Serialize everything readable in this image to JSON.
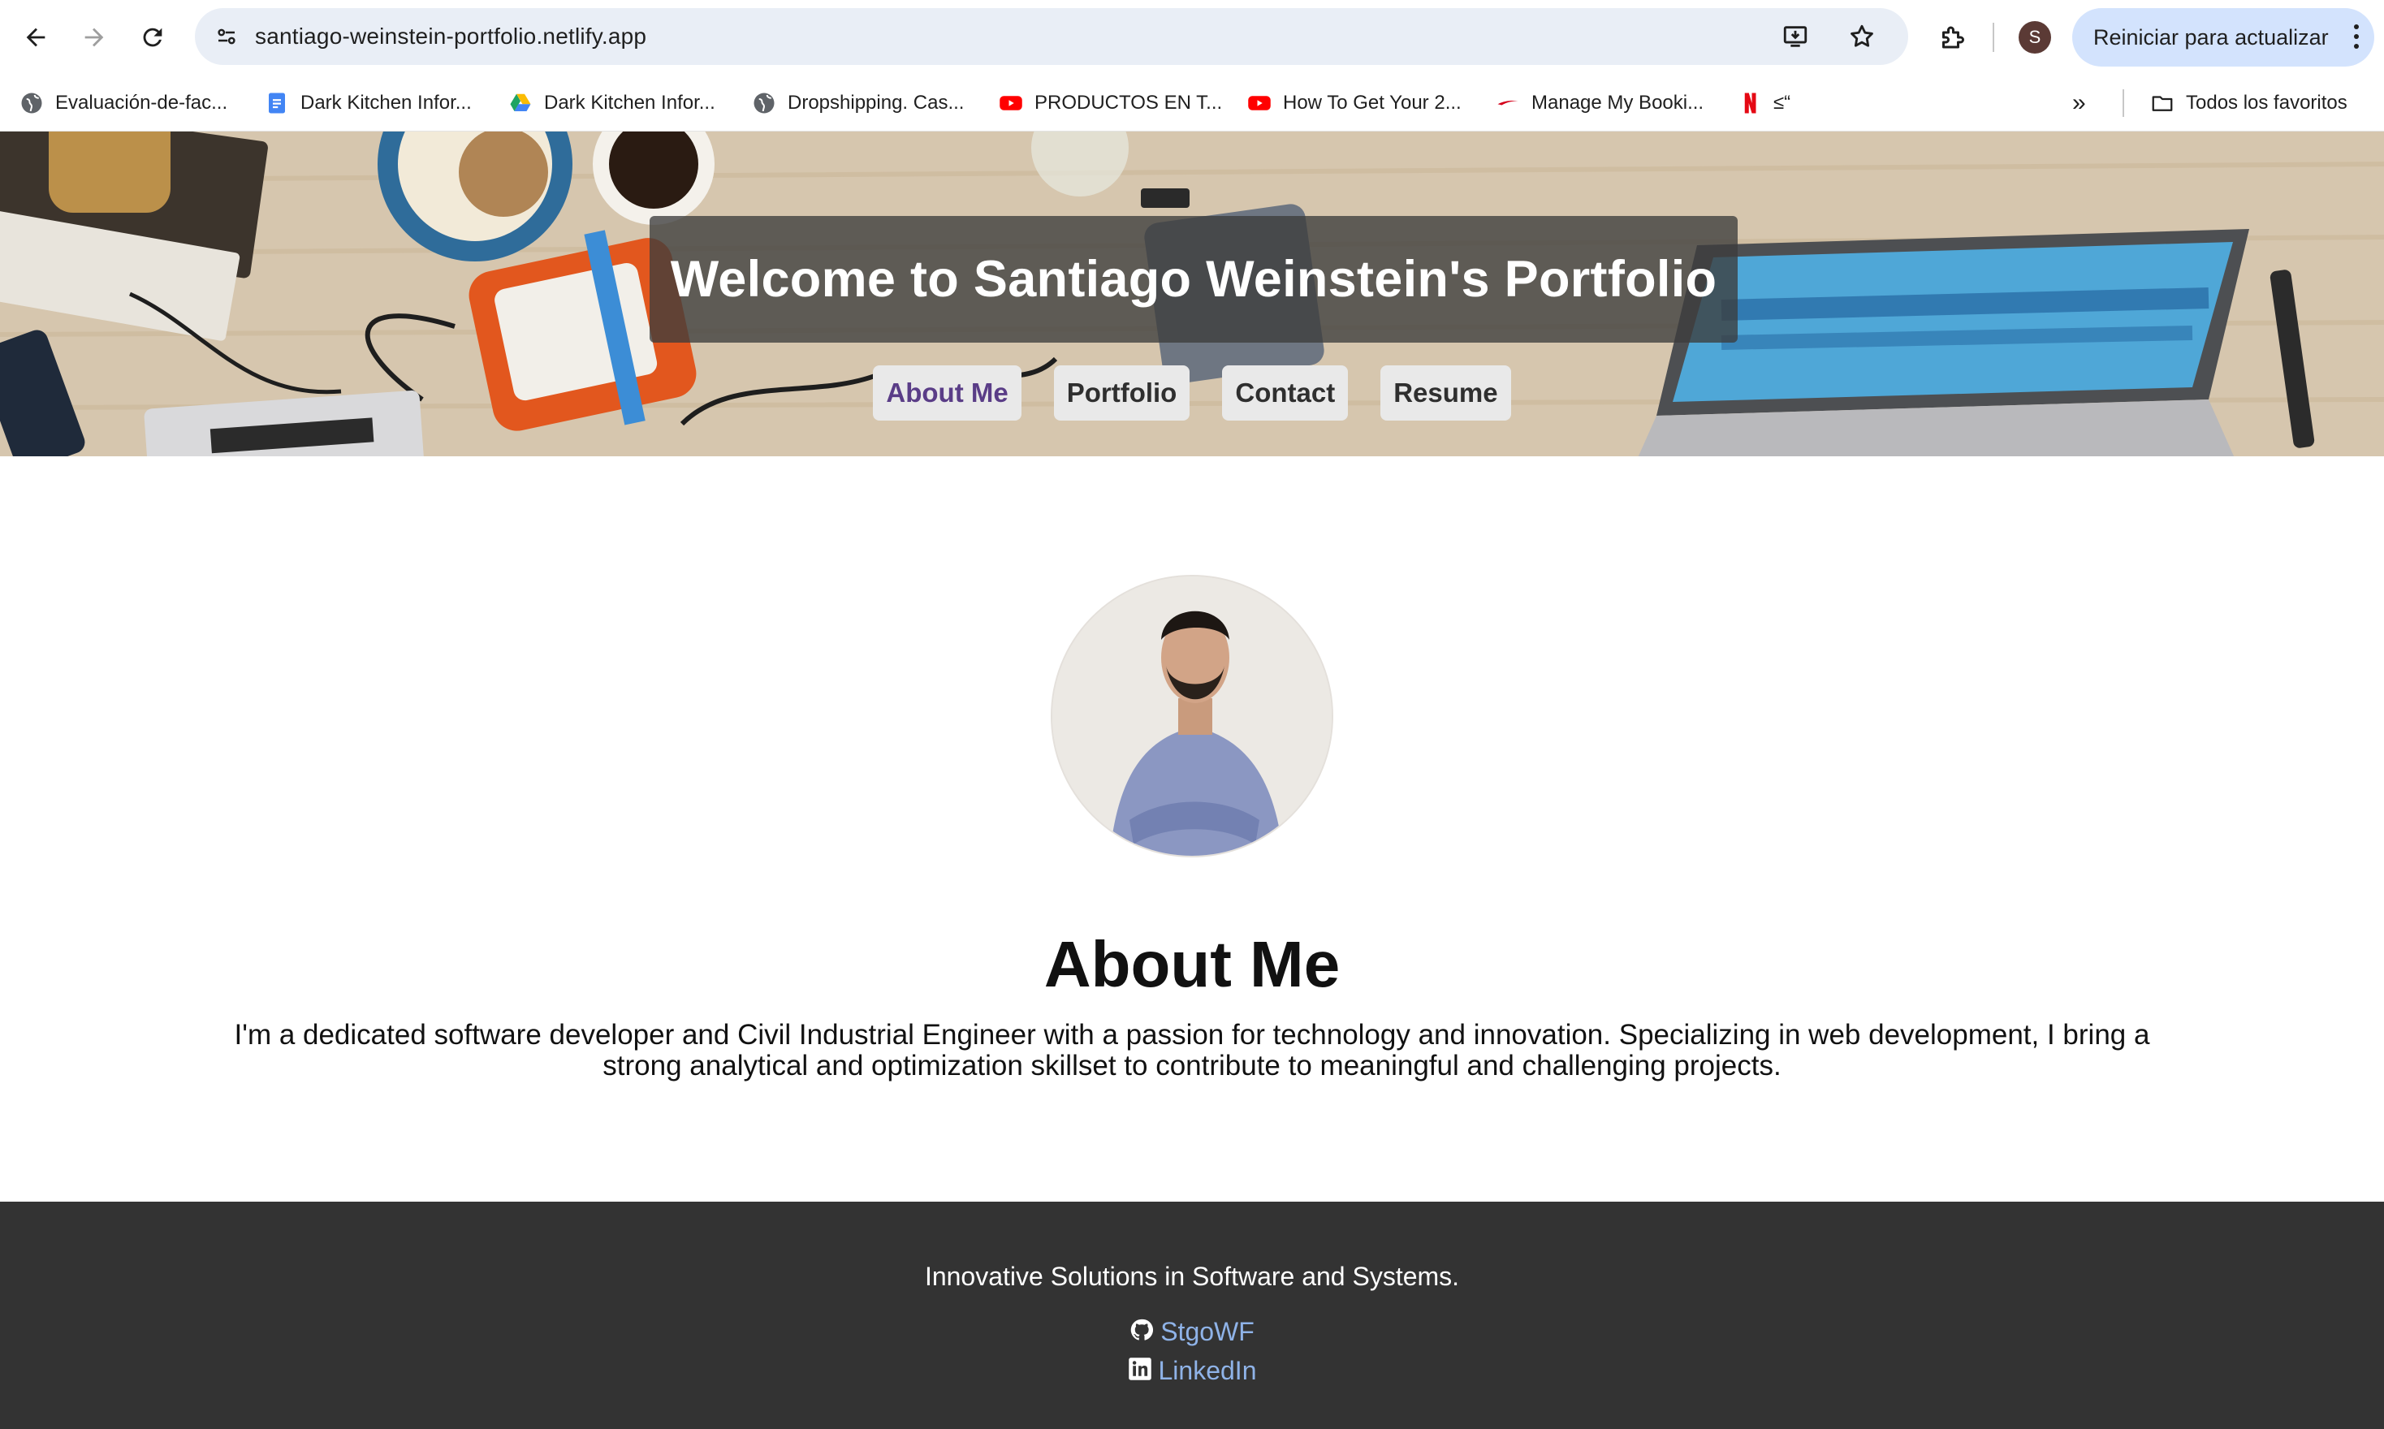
{
  "browser": {
    "url": "santiago-weinstein-portfolio.netlify.app",
    "profile_initial": "S",
    "update_label": "Reiniciar para actualizar",
    "bookmarks": [
      {
        "label": "Evaluación-de-fac...",
        "icon": "globe-icon"
      },
      {
        "label": "Dark Kitchen Infor...",
        "icon": "google-docs-icon"
      },
      {
        "label": "Dark Kitchen Infor...",
        "icon": "google-drive-icon"
      },
      {
        "label": "Dropshipping. Cas...",
        "icon": "globe-icon"
      },
      {
        "label": "PRODUCTOS EN T...",
        "icon": "youtube-icon"
      },
      {
        "label": "How To Get Your 2...",
        "icon": "youtube-icon"
      },
      {
        "label": "Manage My Booki...",
        "icon": "airline-icon"
      },
      {
        "label": "≤“",
        "icon": "netflix-icon"
      }
    ],
    "all_bookmarks_label": "Todos los favoritos"
  },
  "header": {
    "title": "Welcome to Santiago Weinstein's Portfolio",
    "nav": [
      {
        "label": "About Me",
        "active": true
      },
      {
        "label": "Portfolio",
        "active": false
      },
      {
        "label": "Contact",
        "active": false
      },
      {
        "label": "Resume",
        "active": false
      }
    ]
  },
  "about": {
    "heading": "About Me",
    "text": "I'm a dedicated software developer and Civil Industrial Engineer with a passion for technology and innovation. Specializing in web development, I bring a strong analytical and optimization skillset to contribute to meaningful and challenging projects."
  },
  "footer": {
    "tagline": "Innovative Solutions in Software and Systems.",
    "github": "StgoWF",
    "linkedin": "LinkedIn"
  },
  "colors": {
    "active_nav": "#5a3d87",
    "footer_bg": "#333333",
    "footer_link": "#8fb3e8",
    "update_button": "#d3e3fd"
  }
}
